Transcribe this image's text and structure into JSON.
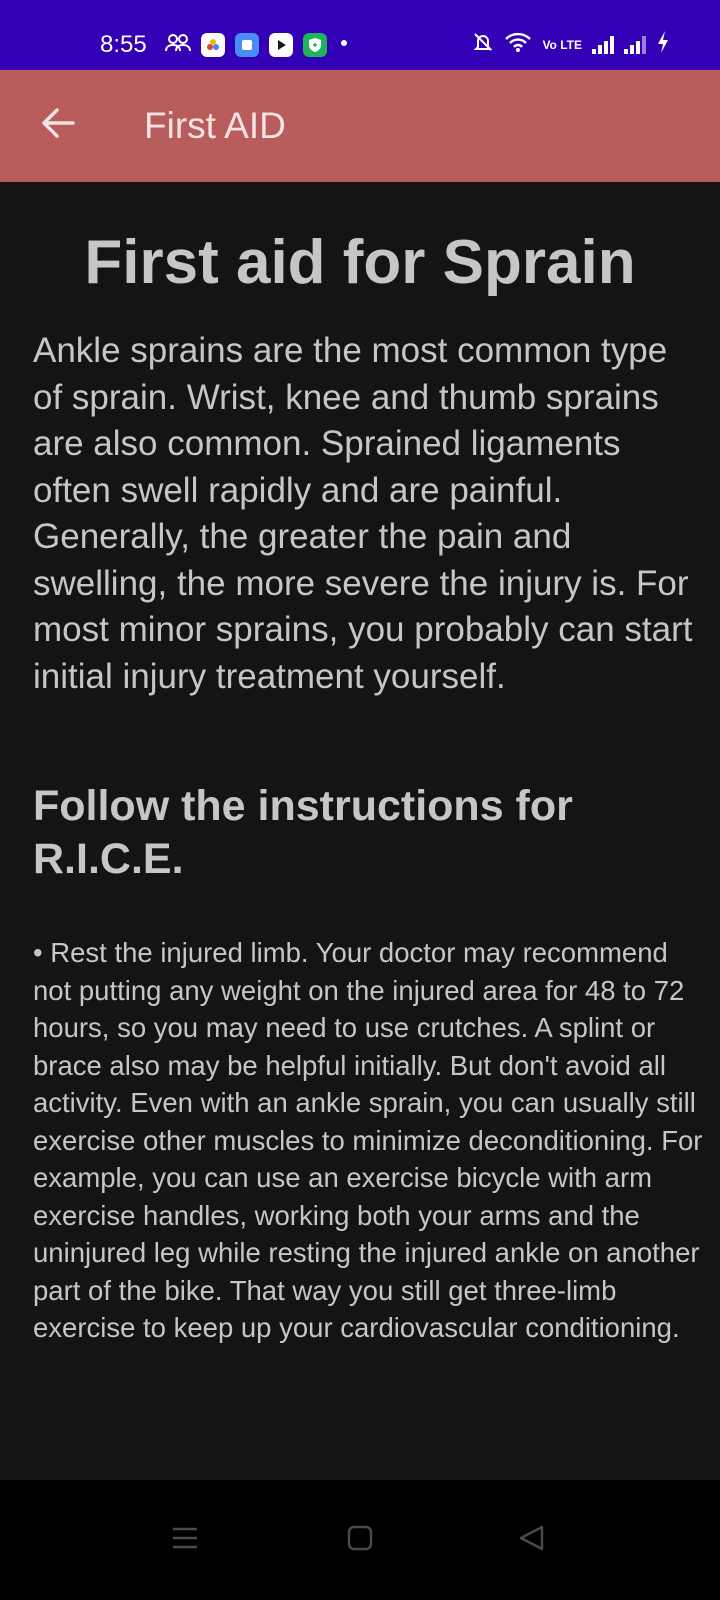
{
  "status_bar": {
    "time": "8:55",
    "network_label": "Vo LTE",
    "notification_icons": [
      "people-icon",
      "photos-app-icon",
      "files-app-icon",
      "youtube-icon",
      "shield-icon",
      "dot-icon"
    ],
    "system_icons": [
      "bell-muted-icon",
      "wifi-icon",
      "volte-icon",
      "signal-icon",
      "signal-icon",
      "charging-icon"
    ],
    "background": "#3300b6"
  },
  "app_bar": {
    "title": "First AID",
    "back_icon": "arrow-left-icon",
    "background": "#b85c5c"
  },
  "article": {
    "title": "First aid for Sprain",
    "intro": "Ankle sprains are the most common type of sprain. Wrist, knee and thumb sprains are also common. Sprained ligaments often swell rapidly and are painful. Generally, the greater the pain and swelling, the more severe the injury is. For most minor sprains, you probably can start initial injury treatment yourself.",
    "section_heading": "Follow the instructions for R.I.C.E.",
    "instructions": "• Rest the injured limb. Your doctor may recommend not putting any weight on the injured area for 48 to 72 hours, so you may need to use crutches. A splint or brace also may be helpful initially. But don't avoid all activity. Even with an ankle sprain, you can usually still exercise other muscles to minimize deconditioning. For example, you can use an exercise bicycle with arm exercise handles, working both your arms and the uninjured leg while resting the injured ankle on another part of the bike. That way you still get three-limb exercise to keep up your cardiovascular conditioning."
  },
  "nav_bar": {
    "buttons": [
      "menu-icon",
      "home-icon",
      "back-triangle-icon"
    ]
  }
}
